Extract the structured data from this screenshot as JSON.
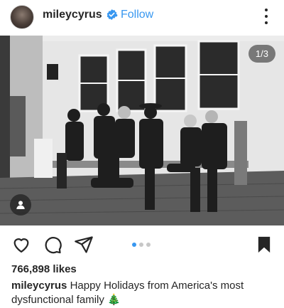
{
  "post": {
    "username": "mileycyrus",
    "separator": "•",
    "follow_label": "Follow",
    "verified": true,
    "image_counter": "1/3",
    "carousel_count": 3,
    "carousel_active_index": 0,
    "likes": "766,898 likes",
    "caption_user": "mileycyrus",
    "caption_text": "Happy Holidays from America's most dysfunctional family",
    "caption_emoji": "🎄"
  },
  "colors": {
    "accent": "#3897f0",
    "text": "#262626"
  },
  "icons": {
    "more": "more-vertical-icon",
    "like": "heart-icon",
    "comment": "comment-bubble-icon",
    "share": "paper-plane-icon",
    "save": "bookmark-icon",
    "tag": "user-tag-icon",
    "verified": "verified-badge-icon"
  }
}
